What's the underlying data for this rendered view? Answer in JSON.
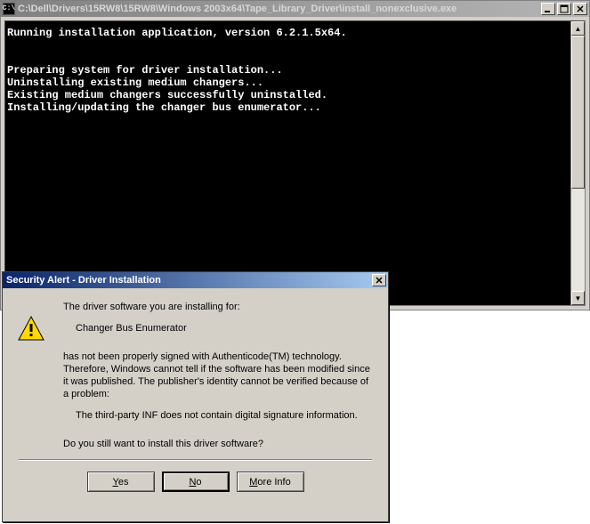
{
  "console": {
    "iconText": "C:\\",
    "title": "C:\\Dell\\Drivers\\15RW8\\15RW8\\Windows 2003x64\\Tape_Library_Driver\\install_nonexclusive.exe",
    "lines": {
      "l1": "Running installation application, version 6.2.1.5x64.",
      "l2": "Preparing system for driver installation...",
      "l3": "Uninstalling existing medium changers...",
      "l4": "Existing medium changers successfully uninstalled.",
      "l5": "Installing/updating the changer bus enumerator..."
    }
  },
  "dialog": {
    "title": "Security Alert - Driver Installation",
    "line_intro": "The driver software you are installing for:",
    "driver_name": "Changer Bus Enumerator",
    "body1": "has not been properly signed with Authenticode(TM) technology. Therefore, Windows cannot tell if the software has been modified since it was published. The publisher's identity cannot be verified because of a problem:",
    "reason": "The third-party INF does not contain digital signature information.",
    "question": "Do you still want to install this driver software?",
    "buttons": {
      "yes_u": "Y",
      "yes_rest": "es",
      "no_u": "N",
      "no_rest": "o",
      "more_u": "M",
      "more_rest": "ore Info"
    }
  }
}
